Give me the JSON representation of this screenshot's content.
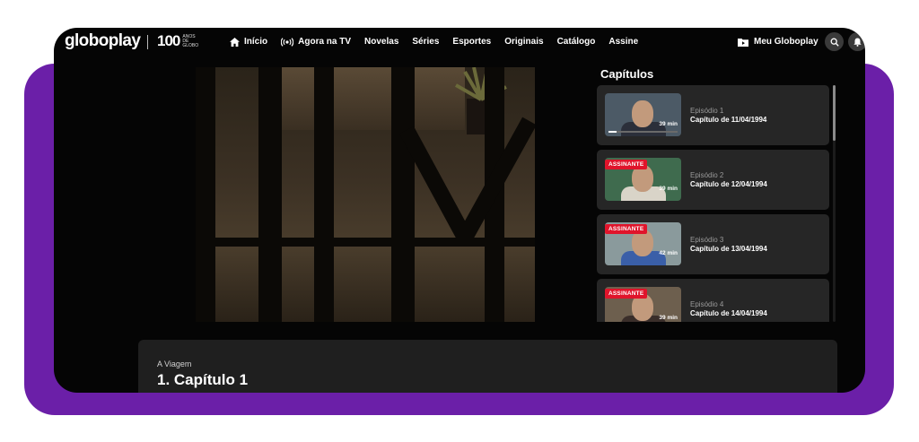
{
  "header": {
    "logo": "globoplay",
    "anniversary_number": "100",
    "anniversary_text": "anos de globo",
    "nav": [
      {
        "label": "Início",
        "icon": "home-icon"
      },
      {
        "label": "Agora na TV",
        "icon": "live-broadcast-icon"
      },
      {
        "label": "Novelas"
      },
      {
        "label": "Séries"
      },
      {
        "label": "Esportes"
      },
      {
        "label": "Originais"
      },
      {
        "label": "Catálogo"
      },
      {
        "label": "Assine"
      }
    ],
    "my_globoplay": "Meu Globoplay"
  },
  "chapters": {
    "title": "Capítulos",
    "items": [
      {
        "episode": "Episódio 1",
        "description": "Capítulo de 11/04/1994",
        "duration": "39 min",
        "badge": "",
        "progress": 0.12,
        "thumb_bg": "#4c5a66",
        "thumb_body": "#2b2f3a"
      },
      {
        "episode": "Episódio 2",
        "description": "Capítulo de 12/04/1994",
        "duration": "39 min",
        "badge": "ASSINANTE",
        "progress": 0,
        "thumb_bg": "#3f6b4e",
        "thumb_body": "#d9d4c8"
      },
      {
        "episode": "Episódio 3",
        "description": "Capítulo de 13/04/1994",
        "duration": "42 min",
        "badge": "ASSINANTE",
        "progress": 0,
        "thumb_bg": "#8a9a9c",
        "thumb_body": "#3a5fa8"
      },
      {
        "episode": "Episódio 4",
        "description": "Capítulo de 14/04/1994",
        "duration": "39 min",
        "badge": "ASSINANTE",
        "progress": 0,
        "thumb_bg": "#6d5f4e",
        "thumb_body": "#3a2e2a"
      }
    ]
  },
  "info": {
    "show_name": "A Viagem",
    "episode_title": "1. Capítulo 1"
  },
  "colors": {
    "purple": "#6b1fa8",
    "badge_red": "#e0142b",
    "card_bg": "#262626"
  }
}
